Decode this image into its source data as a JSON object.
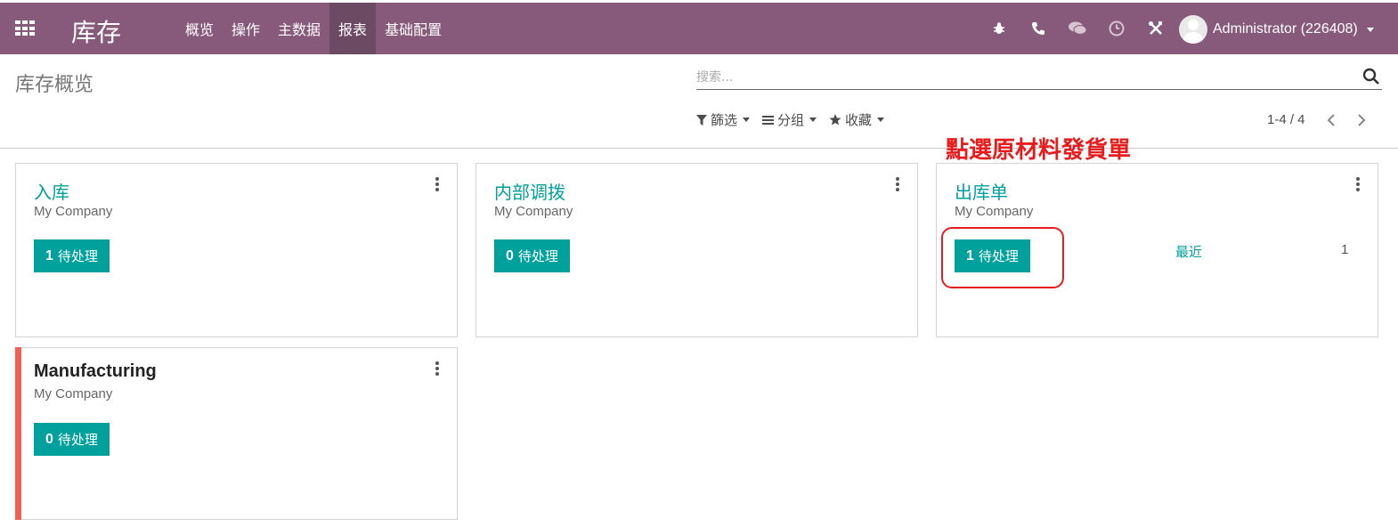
{
  "topbar": {
    "brand": "库存",
    "menu": [
      {
        "label": "概览",
        "active": false
      },
      {
        "label": "操作",
        "active": false
      },
      {
        "label": "主数据",
        "active": false
      },
      {
        "label": "报表",
        "active": true
      },
      {
        "label": "基础配置",
        "active": false
      }
    ],
    "icons": [
      "bug-icon",
      "phone-icon",
      "chat-icon",
      "clock-icon",
      "tools-icon"
    ],
    "user": "Administrator (226408)",
    "color": "#875a7b"
  },
  "control_panel": {
    "title": "库存概览",
    "search": {
      "placeholder": "搜索..."
    },
    "filters": [
      {
        "label": "篩选",
        "icon": "filter-icon"
      },
      {
        "label": "分组",
        "icon": "list-icon"
      },
      {
        "label": "收藏",
        "icon": "star-icon"
      }
    ],
    "pager": "1-4 / 4"
  },
  "annotation": "點選原材料發貨單",
  "cards": [
    {
      "title": "入库",
      "company": "My Company",
      "count": "1",
      "pending_label": "待处理"
    },
    {
      "title": "内部调拨",
      "company": "My Company",
      "count": "0",
      "pending_label": "待处理"
    },
    {
      "title": "出库单",
      "company": "My Company",
      "count": "1",
      "pending_label": "待处理",
      "recent_label": "最近",
      "recent_count": "1"
    },
    {
      "title": "Manufacturing",
      "company": "My Company",
      "count": "0",
      "pending_label": "待处理",
      "accent": "#f06050"
    }
  ],
  "accent_color": "#00a09d"
}
